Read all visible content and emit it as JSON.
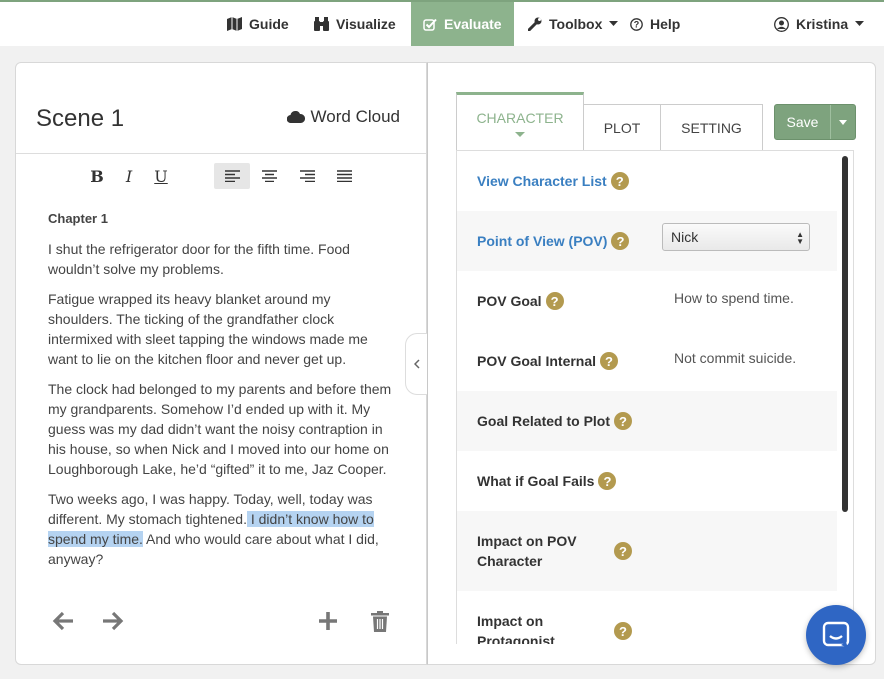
{
  "nav": {
    "guide": "Guide",
    "visualize": "Visualize",
    "evaluate": "Evaluate",
    "toolbox": "Toolbox",
    "help": "Help",
    "user": "Kristina"
  },
  "scene": {
    "title": "Scene 1",
    "word_cloud": "Word Cloud"
  },
  "editor": {
    "chapter": "Chapter 1",
    "paragraphs": [
      "I shut the refrigerator door for the fifth time. Food wouldn’t solve my problems.",
      "Fatigue wrapped its heavy blanket around my shoulders. The ticking of the grandfather clock intermixed with sleet tapping the windows made me want to lie on the kitchen floor and never get up.",
      "The clock had belonged to my parents and before them my grandparents. Somehow I’d ended up with it. My guess was my dad didn’t want the noisy contraption in his house, so when Nick and I moved into our home on Loughborough Lake, he’d “gifted” it to me, Jaz Cooper."
    ],
    "last_paragraph": {
      "before": "Two weeks ago, I was happy. Today, well, today was different. My stomach tightened.",
      "highlight": " I didn’t know how to spend my time.",
      "after": " And who would care about what I did, anyway?"
    }
  },
  "toolbar": {
    "bold": "B",
    "italic": "I",
    "underline": "U"
  },
  "tabs": {
    "character": "CHARACTER",
    "plot": "PLOT",
    "setting": "SETTING"
  },
  "save": "Save",
  "fields": {
    "view_list": "View Character List",
    "pov": "Point of View (POV)",
    "pov_value": "Nick",
    "pov_goal": "POV Goal",
    "pov_goal_value": "How to spend time.",
    "pov_goal_internal": "POV Goal Internal",
    "pov_goal_internal_value": "Not commit suicide.",
    "goal_related": "Goal Related to Plot",
    "what_if": "What if Goal Fails",
    "impact_pov_1": "Impact on POV",
    "impact_pov_2": "Character",
    "impact_prot_1": "Impact on",
    "impact_prot_2": "Protagonist"
  },
  "help_glyph": "?",
  "colors": {
    "accent": "#8db38d",
    "link": "#3a7fc1",
    "help_icon": "#b39a4f",
    "chat": "#2f66c4"
  }
}
